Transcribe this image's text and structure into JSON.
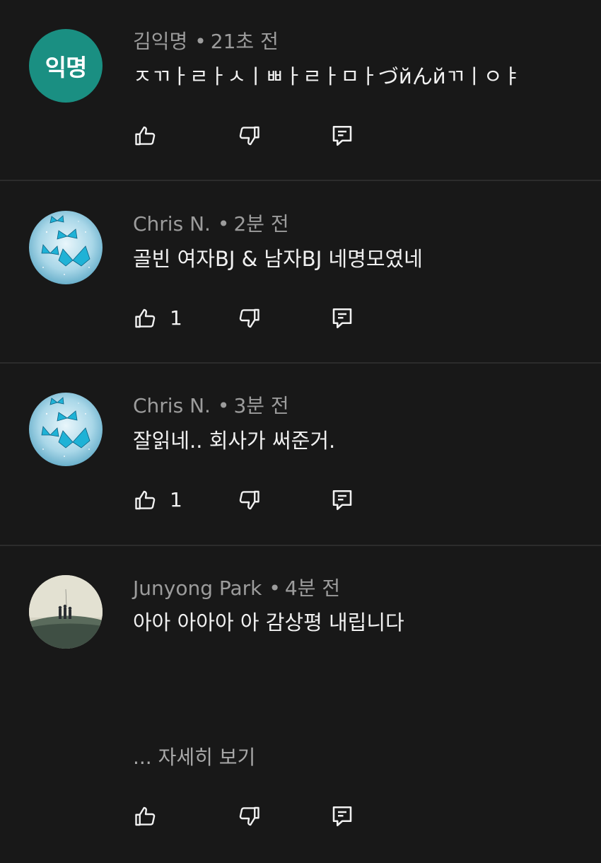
{
  "comments": [
    {
      "author": "김익명",
      "time": "21초 전",
      "text": "ㅈㄲㅏㄹㅏㅅㅣㅃㅏㄹㅏㅁㅏづйんйㄲㅣㅇㅑ",
      "likes": "",
      "avatar": {
        "type": "text",
        "label": "익명",
        "color": "#1a8f82"
      }
    },
    {
      "author": "Chris N.",
      "time": "2분 전",
      "text": "골빈 여자BJ & 남자BJ 네명모였네",
      "likes": "1",
      "avatar": {
        "type": "image",
        "subject": "blue-butterflies"
      }
    },
    {
      "author": "Chris N.",
      "time": "3분 전",
      "text": "잘읽네.. 회사가 써준거.",
      "likes": "1",
      "avatar": {
        "type": "image",
        "subject": "blue-butterflies"
      }
    },
    {
      "author": "Junyong Park",
      "time": "4분 전",
      "text": "아아 아아아 아 감상평 내립니다",
      "likes": "",
      "more_label": "... 자세히 보기",
      "avatar": {
        "type": "image",
        "subject": "people-on-hill"
      }
    }
  ],
  "separator": "•",
  "icons": {
    "like": "thumbs-up-icon",
    "dislike": "thumbs-down-icon",
    "reply": "comment-reply-icon"
  },
  "colors": {
    "background": "#181818",
    "divider": "#2c2c2c",
    "meta_text": "#9c9c9c",
    "body_text": "#f1f1f1",
    "anon_avatar": "#1a8f82"
  }
}
